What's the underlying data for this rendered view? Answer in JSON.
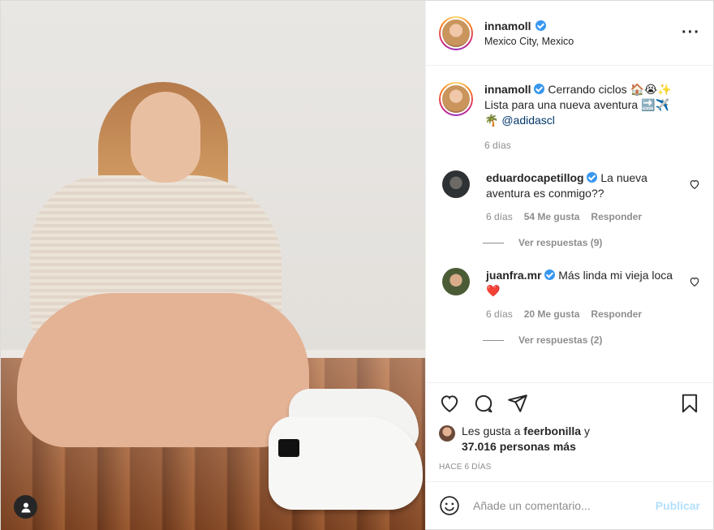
{
  "post": {
    "author": "innamoll",
    "location": "Mexico City, Mexico",
    "more_icon": "more-horizontal-icon",
    "caption": {
      "username": "innamoll",
      "text_line1": "Cerrando ciclos 🏠😭✨",
      "text_line2": "Lista para una nueva aventura 🔜✈️",
      "text_line3_prefix": "🌴",
      "mention": "@adidascl",
      "age": "6 días"
    },
    "comments": [
      {
        "username": "eduardocapetillog",
        "text": "La nueva aventura es conmigo??",
        "age": "6 días",
        "likes": "54 Me gusta",
        "reply_label": "Responder",
        "view_replies": "Ver respuestas (9)"
      },
      {
        "username": "juanfra.mr",
        "text": "Más linda mi vieja loca❤️",
        "age": "6 días",
        "likes": "20 Me gusta",
        "reply_label": "Responder",
        "view_replies": "Ver respuestas (2)"
      }
    ],
    "likes": {
      "prefix": "Les gusta a",
      "liker": "feerbonilla",
      "and": "y",
      "others": "37.016 personas más"
    },
    "timestamp": "HACE 6 DÍAS",
    "add_comment": {
      "placeholder": "Añade un comentario...",
      "publish_label": "Publicar"
    }
  },
  "colors": {
    "verified": "#3897f0",
    "mention": "#00376b",
    "muted": "#8e8e8e",
    "publish_disabled": "#b2dffc"
  }
}
